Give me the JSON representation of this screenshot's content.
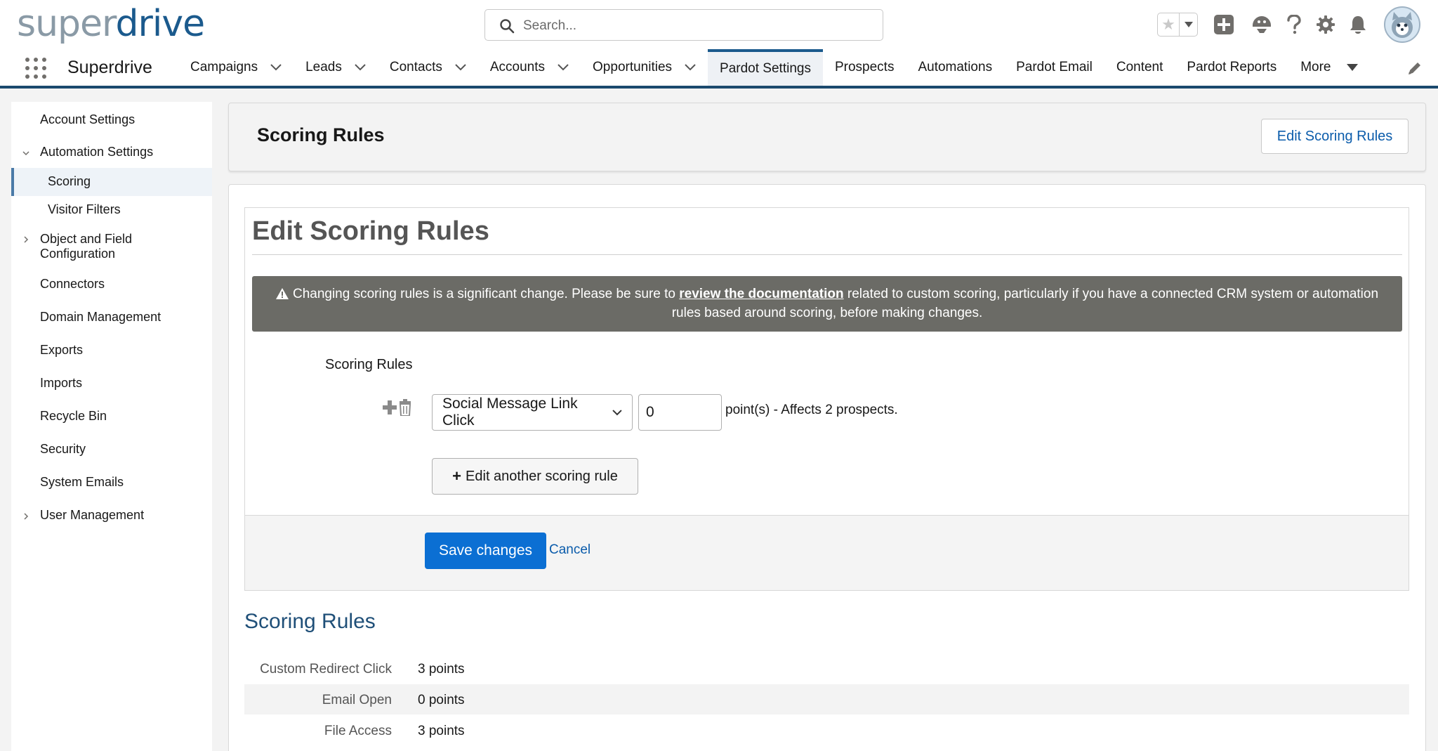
{
  "header": {
    "logo_part1": "super",
    "logo_part2": "drive",
    "search_placeholder": "Search...",
    "icons": [
      "star-icon",
      "chevron-down-icon",
      "add-icon",
      "trailhead-icon",
      "help-icon",
      "gear-icon",
      "bell-icon",
      "avatar"
    ]
  },
  "nav": {
    "app_name": "Superdrive",
    "items": [
      {
        "label": "Campaigns",
        "dropdown": true
      },
      {
        "label": "Leads",
        "dropdown": true
      },
      {
        "label": "Contacts",
        "dropdown": true
      },
      {
        "label": "Accounts",
        "dropdown": true
      },
      {
        "label": "Opportunities",
        "dropdown": true
      },
      {
        "label": "Pardot Settings",
        "dropdown": false,
        "active": true
      },
      {
        "label": "Prospects",
        "dropdown": false
      },
      {
        "label": "Automations",
        "dropdown": false
      },
      {
        "label": "Pardot Email",
        "dropdown": false
      },
      {
        "label": "Content",
        "dropdown": false
      },
      {
        "label": "Pardot Reports",
        "dropdown": false
      },
      {
        "label": "More",
        "dropdown": true
      }
    ]
  },
  "sidebar": {
    "items": [
      {
        "label": "Account Settings"
      },
      {
        "label": "Automation Settings",
        "expanded": true
      },
      {
        "label": "Scoring",
        "selected": true
      },
      {
        "label": "Visitor Filters"
      },
      {
        "label": "Object and Field",
        "label2": "Configuration",
        "collapsed": true
      },
      {
        "label": "Connectors"
      },
      {
        "label": "Domain Management"
      },
      {
        "label": "Exports"
      },
      {
        "label": "Imports"
      },
      {
        "label": "Recycle Bin"
      },
      {
        "label": "Security"
      },
      {
        "label": "System Emails"
      },
      {
        "label": "User Management",
        "collapsed": true
      }
    ]
  },
  "page": {
    "title": "Scoring Rules",
    "edit_button": "Edit Scoring Rules"
  },
  "edit_panel": {
    "title": "Edit Scoring Rules",
    "alert_before": "Changing scoring rules is a significant change. Please be sure to ",
    "alert_link": "review the documentation",
    "alert_after": " related to custom scoring, particularly if you have a connected CRM system or automation rules based around scoring, before making changes.",
    "section_label": "Scoring Rules",
    "rule_select_value": "Social Message Link Click",
    "rule_points_value": "0",
    "rule_affects": "point(s) - Affects 2 prospects.",
    "add_rule_button": "Edit another scoring rule",
    "save_button": "Save changes",
    "cancel_link": "Cancel"
  },
  "scoring_rules": {
    "heading": "Scoring Rules",
    "rows": [
      {
        "name": "Custom Redirect Click",
        "value": "3 points"
      },
      {
        "name": "Email Open",
        "value": "0 points"
      },
      {
        "name": "File Access",
        "value": "3 points"
      }
    ]
  },
  "colors": {
    "brand_blue": "#1b5a8d",
    "primary_button": "#0b6fd3",
    "link": "#0b5cab",
    "alert_bg": "#6b6b66"
  }
}
